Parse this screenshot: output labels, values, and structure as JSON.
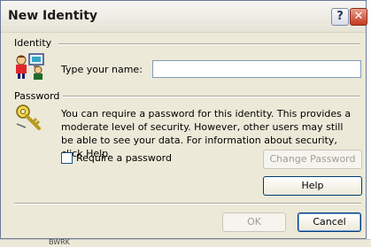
{
  "window": {
    "title": "New Identity",
    "help_glyph": "?",
    "close_glyph": "✕"
  },
  "identity": {
    "section_label": "Identity",
    "name_label": "Type your name:",
    "name_value": ""
  },
  "password": {
    "section_label": "Password",
    "description": "You can require a password for this identity.  This provides a moderate level of security. However, other users may still be able to see your data. For information about security, click Help.",
    "require_label": "Require a password",
    "require_checked": false,
    "change_button": "Change Password",
    "help_button": "Help"
  },
  "footer": {
    "ok_button": "OK",
    "cancel_button": "Cancel"
  },
  "background": {
    "partial_text": "BWRK"
  },
  "icons": {
    "identity": "users-icon",
    "password": "key-icon"
  }
}
